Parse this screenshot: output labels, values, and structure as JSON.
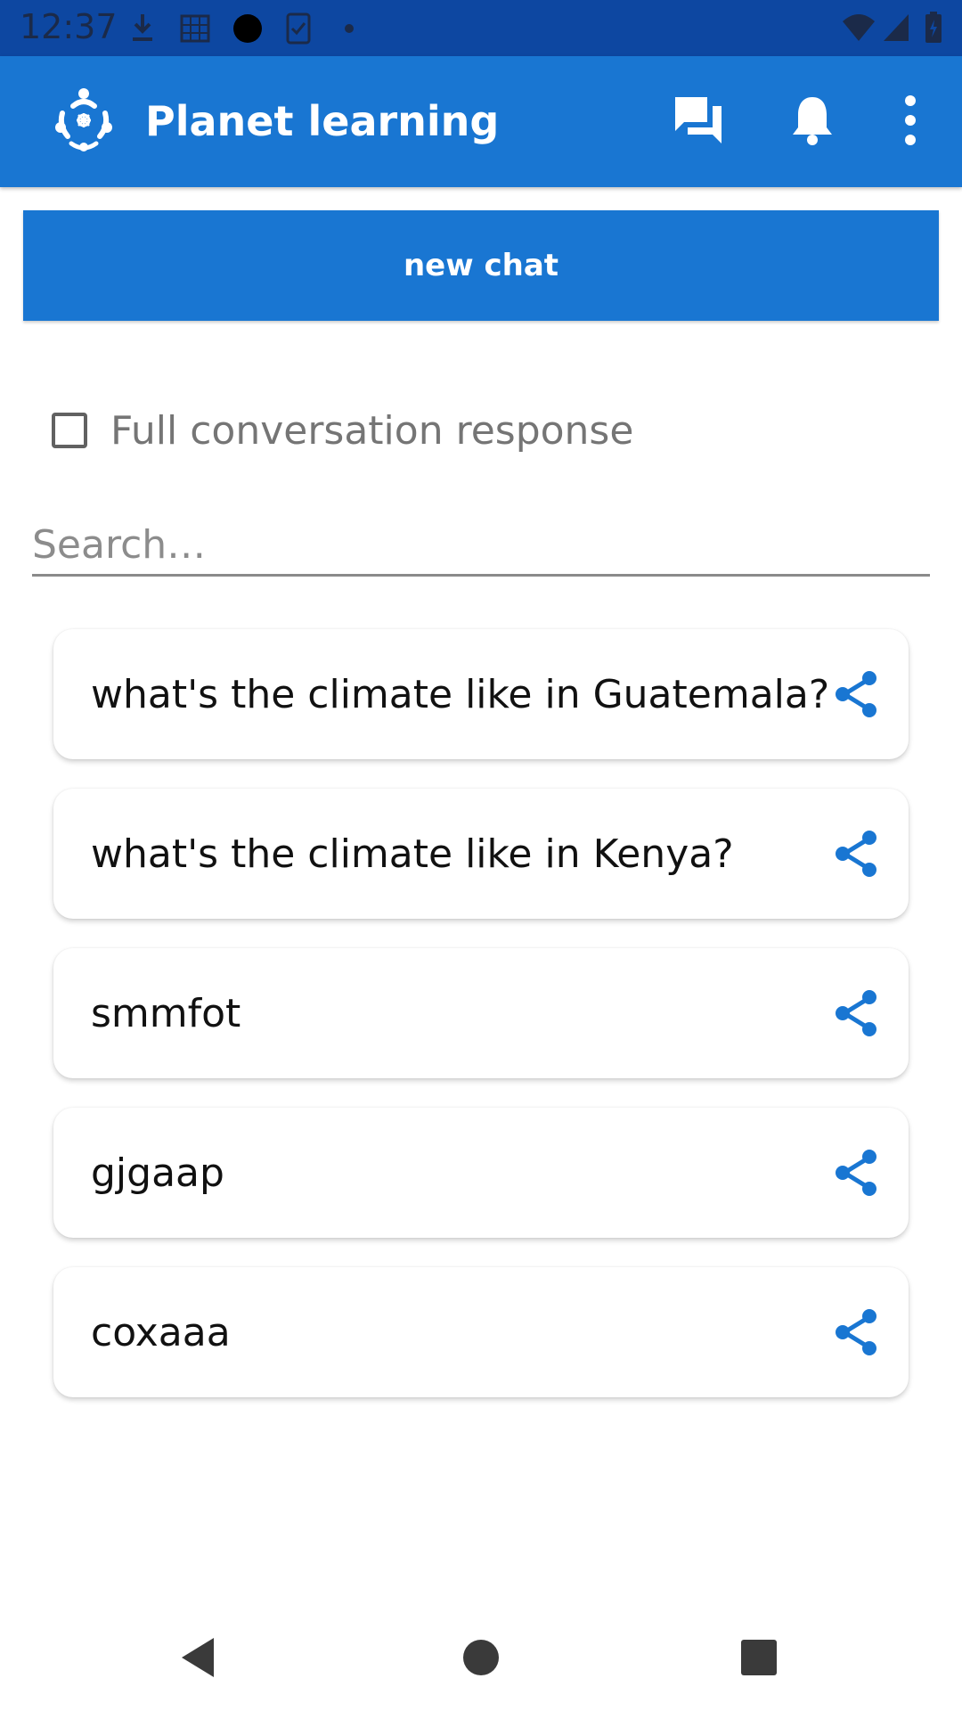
{
  "status_bar": {
    "time": "12:37",
    "icons": [
      "download-icon",
      "calendar-grid-icon",
      "circle-icon",
      "clipboard-check-icon",
      "dot-icon",
      "wifi-icon",
      "signal-icon",
      "battery-icon"
    ]
  },
  "app_bar": {
    "title": "Planet learning",
    "logo_icon": "planet-learning-logo",
    "actions": [
      "chat-icon",
      "bell-icon",
      "more-vertical-icon"
    ]
  },
  "new_chat_button": {
    "label": "new chat"
  },
  "full_conversation": {
    "label": "Full conversation response",
    "checked": false
  },
  "search": {
    "placeholder": "Search…",
    "value": ""
  },
  "chats": [
    {
      "title": "what's the climate like in Guatemala?"
    },
    {
      "title": "what's the climate like in Kenya?"
    },
    {
      "title": "smmfot"
    },
    {
      "title": "gjgaap"
    },
    {
      "title": "coxaaa"
    }
  ],
  "nav": [
    "back-icon",
    "home-icon",
    "recents-icon"
  ],
  "colors": {
    "primary": "#1976d2",
    "status_bar": "#0d47a1",
    "share": "#1976d2"
  }
}
